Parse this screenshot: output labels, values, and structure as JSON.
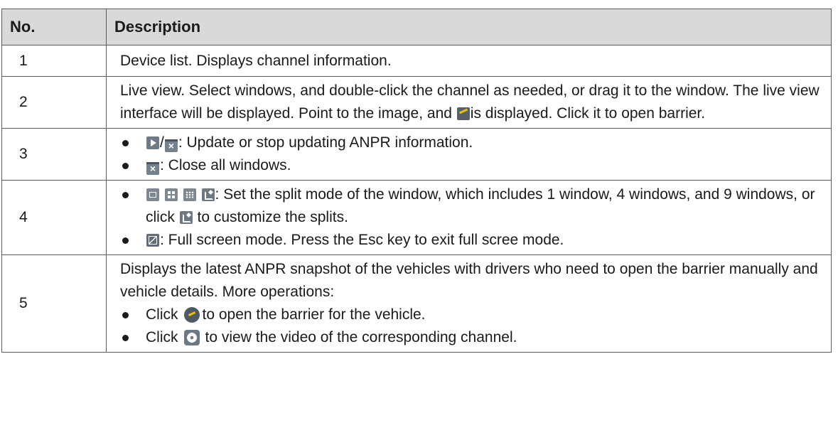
{
  "headers": {
    "no": "No.",
    "description": "Description"
  },
  "rows": {
    "r1": {
      "no": "1",
      "text": "Device list. Displays channel information."
    },
    "r2": {
      "no": "2",
      "text_before": "Live view. Select windows, and double-click the channel as needed, or drag it to the window. The live view interface will be displayed. Point to the image, and ",
      "text_after": "is displayed. Click it to open barrier."
    },
    "r3": {
      "no": "3",
      "separator": "/",
      "b1_text": ": Update or stop updating ANPR information.",
      "b2_text": ": Close all windows."
    },
    "r4": {
      "no": "4",
      "b1_text_before": ": Set the split mode of the window, which includes 1 window, 4 windows, and 9 windows, or click ",
      "b1_text_after": " to customize the splits.",
      "b2_text": ": Full screen mode. Press the Esc key to exit full scree mode."
    },
    "r5": {
      "no": "5",
      "intro": "Displays the latest ANPR snapshot of the vehicles with drivers who need to open the barrier manually and vehicle details. More operations:",
      "b1_before": "Click",
      "b1_after": "to open the barrier for the vehicle.",
      "b2_before": "Click",
      "b2_after": "to view the video of the corresponding channel."
    }
  },
  "icons": {
    "open_barrier": "open-barrier-icon",
    "update": "play-icon",
    "stop_update": "stop-update-icon",
    "close_all": "close-all-windows-icon",
    "split_1": "split-1-window-icon",
    "split_4": "split-4-windows-icon",
    "split_9": "split-9-windows-icon",
    "custom_split": "custom-split-icon",
    "full_screen": "full-screen-icon",
    "open_barrier_round": "open-barrier-round-icon",
    "video": "video-playback-icon"
  }
}
